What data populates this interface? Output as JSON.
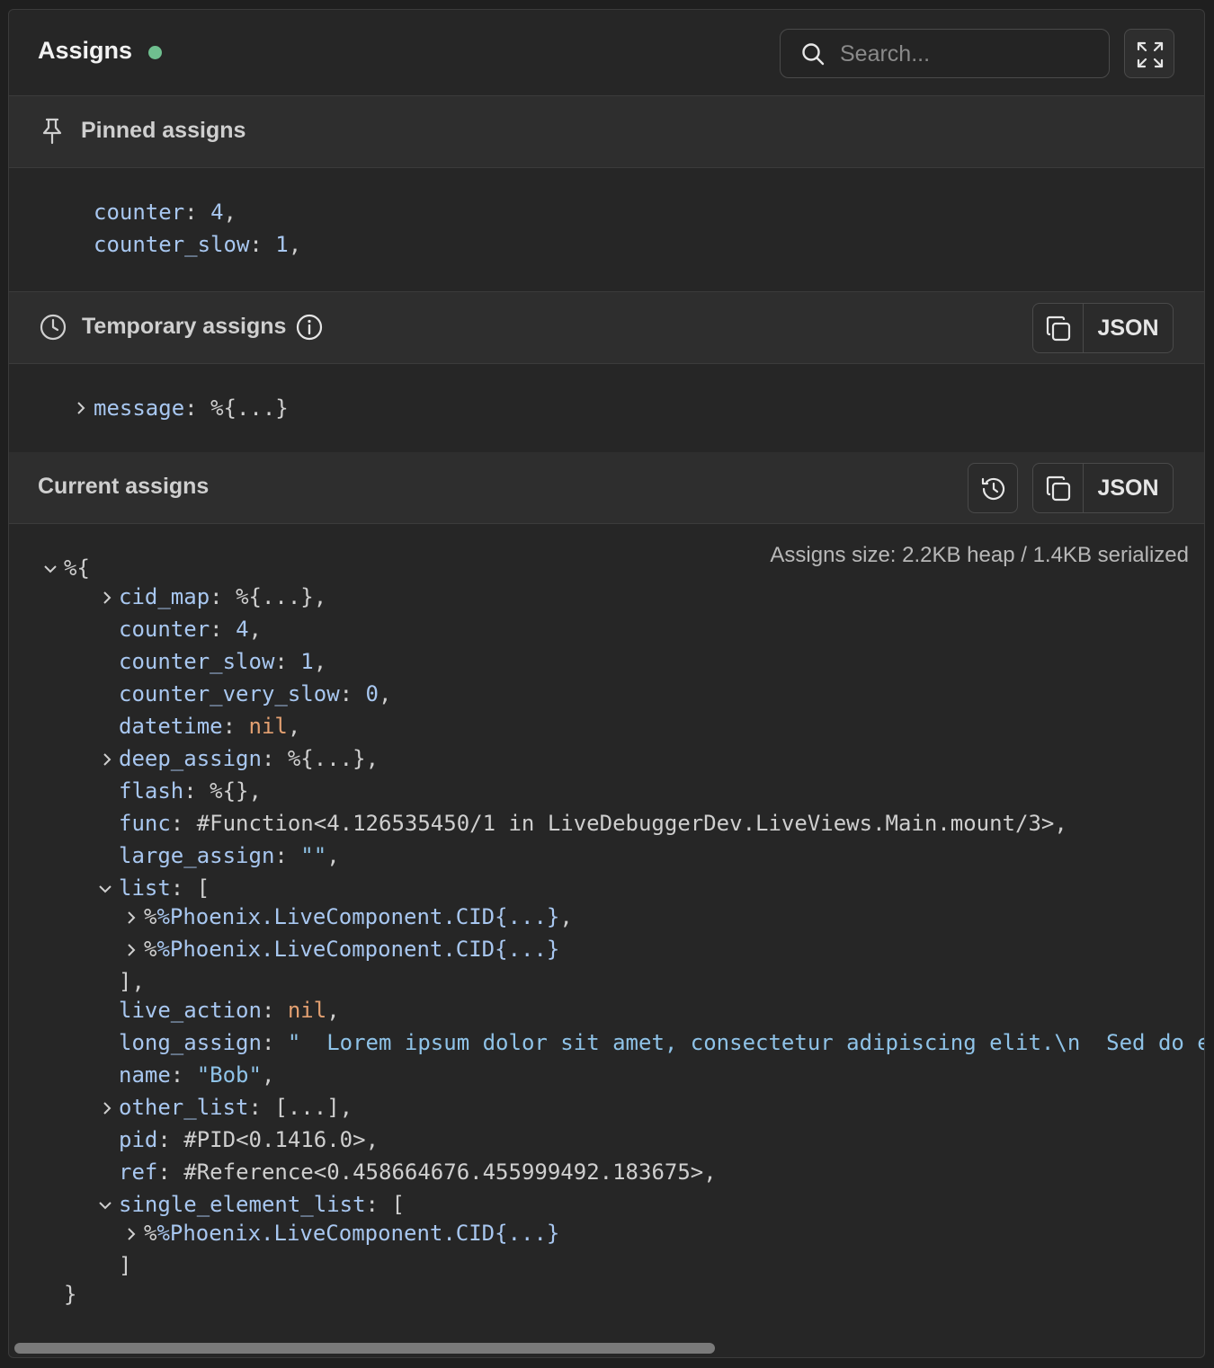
{
  "header": {
    "title": "Assigns",
    "status_color": "#6fbf8f",
    "search_placeholder": "Search...",
    "expand_icon": "expand-icon"
  },
  "pinned": {
    "label": "Pinned assigns",
    "icon": "pin-icon",
    "lines": [
      {
        "key": "counter",
        "value": "4",
        "trail": ","
      },
      {
        "key": "counter_slow",
        "value": "1",
        "trail": ","
      }
    ]
  },
  "temporary": {
    "label": "Temporary assigns",
    "icon": "clock-icon",
    "info_icon": "info-icon",
    "json_label": "JSON",
    "lines": [
      {
        "key": "message",
        "value": "%{...}",
        "trail": ""
      }
    ]
  },
  "current": {
    "label": "Current assigns",
    "json_label": "JSON",
    "size_text": "Assigns size: 2.2KB heap / 1.4KB serialized",
    "open": "%{",
    "close": "}",
    "lines": [
      {
        "key": "cid_map",
        "value": "%{...}",
        "trail": ","
      },
      {
        "key": "counter",
        "value": "4",
        "trail": ","
      },
      {
        "key": "counter_slow",
        "value": "1",
        "trail": ","
      },
      {
        "key": "counter_very_slow",
        "value": "0",
        "trail": ","
      },
      {
        "key": "datetime",
        "value": "nil",
        "trail": ","
      },
      {
        "key": "deep_assign",
        "value": "%{...}",
        "trail": ","
      },
      {
        "key": "flash",
        "value": "%{}",
        "trail": ","
      },
      {
        "key": "func",
        "value": "#Function<4.126535450/1 in LiveDebuggerDev.LiveViews.Main.mount/3>",
        "trail": ","
      },
      {
        "key": "large_assign",
        "value": "\"\"",
        "trail": ","
      },
      {
        "key": "list",
        "value": "[",
        "trail": ""
      },
      {
        "key": "",
        "value": "%Phoenix.LiveComponent.CID{...}",
        "trail": ","
      },
      {
        "key": "",
        "value": "%Phoenix.LiveComponent.CID{...}",
        "trail": ""
      },
      {
        "key": "",
        "value": "],",
        "trail": ""
      },
      {
        "key": "live_action",
        "value": "nil",
        "trail": ","
      },
      {
        "key": "long_assign",
        "value": "\"  Lorem ipsum dolor sit amet, consectetur adipiscing elit.\\n  Sed do e",
        "trail": ""
      },
      {
        "key": "name",
        "value": "\"Bob\"",
        "trail": ","
      },
      {
        "key": "other_list",
        "value": "[...]",
        "trail": ","
      },
      {
        "key": "pid",
        "value": "#PID<0.1416.0>",
        "trail": ","
      },
      {
        "key": "ref",
        "value": "#Reference<0.458664676.455999492.183675>",
        "trail": ","
      },
      {
        "key": "single_element_list",
        "value": "[",
        "trail": ""
      },
      {
        "key": "",
        "value": "%Phoenix.LiveComponent.CID{...}",
        "trail": ""
      },
      {
        "key": "",
        "value": "]",
        "trail": ""
      }
    ]
  }
}
